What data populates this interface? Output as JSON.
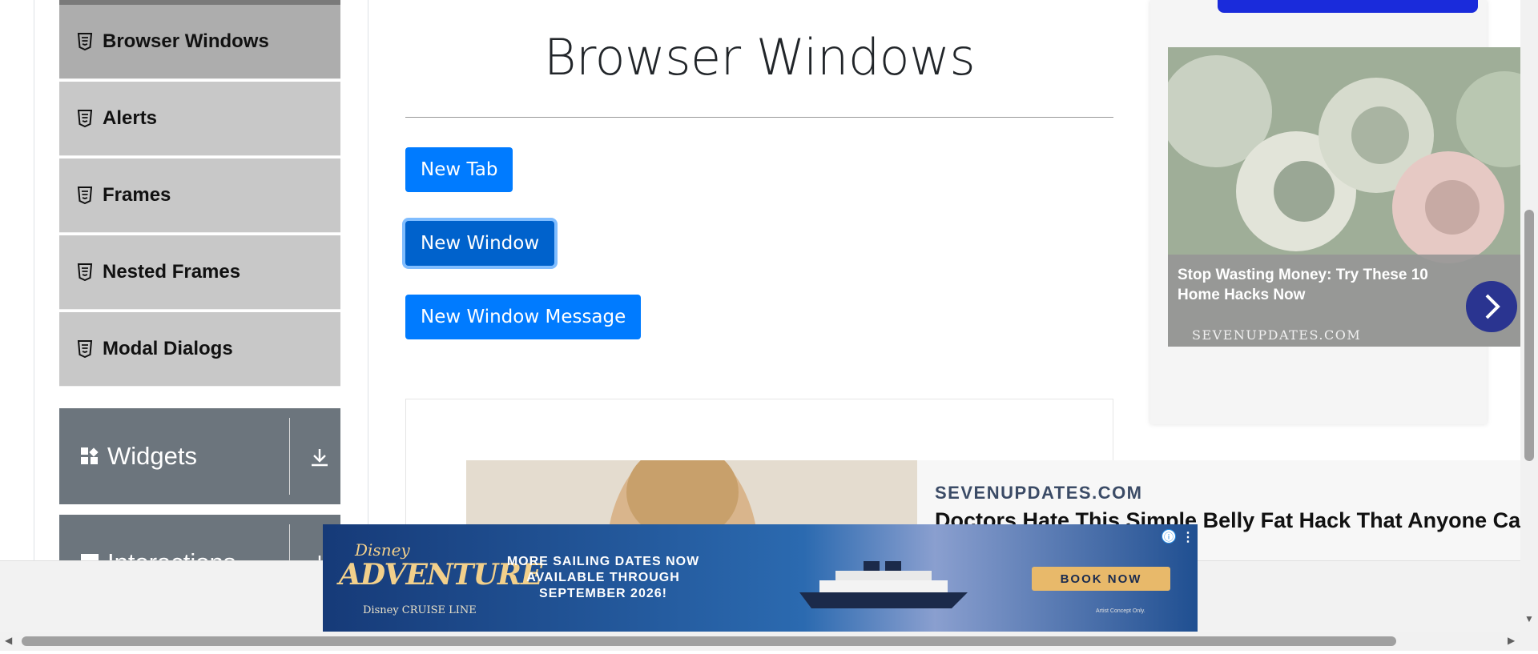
{
  "sidebar": {
    "items": [
      {
        "label": "Browser Windows",
        "active": true
      },
      {
        "label": "Alerts",
        "active": false
      },
      {
        "label": "Frames",
        "active": false
      },
      {
        "label": "Nested Frames",
        "active": false
      },
      {
        "label": "Modal Dialogs",
        "active": false
      }
    ],
    "item_icon": "html5-icon",
    "groups": [
      {
        "label": "Widgets",
        "icon": "widgets-grid-icon",
        "arrow": "download-arrow-icon"
      },
      {
        "label": "Interactions",
        "icon": "interactions-icon",
        "arrow": "download-arrow-icon"
      }
    ]
  },
  "main": {
    "title": "Browser Windows",
    "buttons": {
      "new_tab": "New Tab",
      "new_window": "New Window",
      "new_window_message": "New Window Message"
    }
  },
  "ads": {
    "right": {
      "title": "Stop Wasting Money: Try These 10 Home Hacks Now",
      "source": "SEVENUPDATES.COM",
      "arrow_icon": "chevron-right-icon"
    },
    "bottom": {
      "source": "SEVENUPDATES.COM",
      "title": "Doctors Hate This Simple Belly Fat Hack That Anyone Ca"
    },
    "banner": {
      "brand_line1": "Disney",
      "brand_line2": "ADVENTURE",
      "brand_line3": "Disney CRUISE LINE",
      "message": "MORE SAILING DATES NOW AVAILABLE THROUGH SEPTEMBER 2026!",
      "cta": "BOOK NOW",
      "fine_print": "Artist Concept Only.",
      "info_icon": "ⓘ",
      "menu_icon": "⋮"
    }
  },
  "colors": {
    "primary": "#007bff",
    "sidebar_item": "#c8c8c8",
    "sidebar_active": "#adadad",
    "group_header": "#6c757d"
  }
}
